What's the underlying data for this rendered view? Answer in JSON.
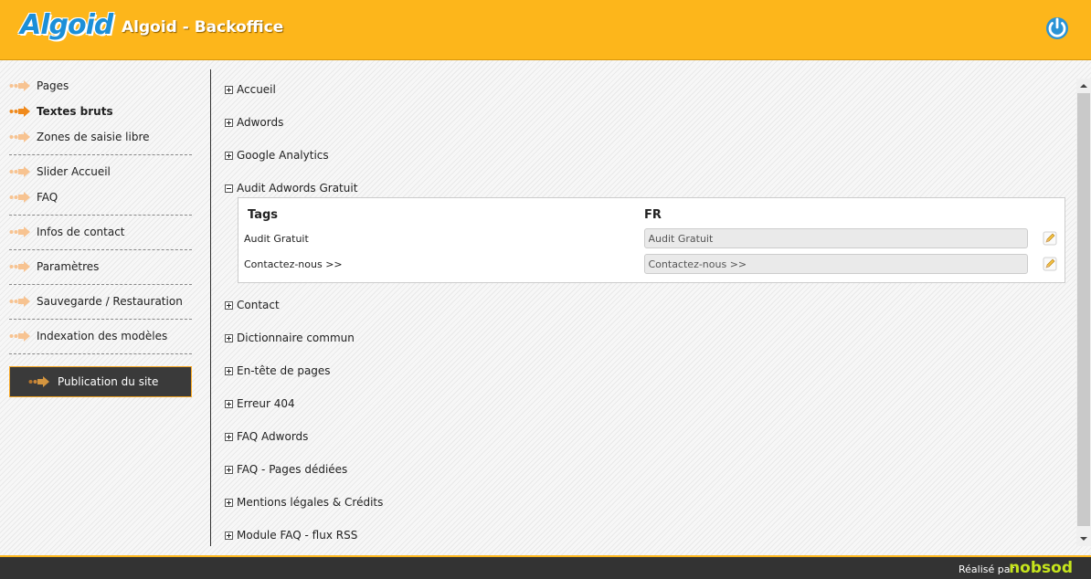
{
  "header": {
    "logo_text": "Algoid",
    "title": "Algoid - Backoffice",
    "power_icon": "power-icon",
    "color": "#fdb61b"
  },
  "sidebar": {
    "groups": [
      [
        {
          "label": "Pages",
          "active": false
        },
        {
          "label": "Textes bruts",
          "active": true
        },
        {
          "label": "Zones de saisie libre",
          "active": false
        }
      ],
      [
        {
          "label": "Slider Accueil",
          "active": false
        },
        {
          "label": "FAQ",
          "active": false
        }
      ],
      [
        {
          "label": "Infos de contact",
          "active": false
        }
      ],
      [
        {
          "label": "Paramètres",
          "active": false
        }
      ],
      [
        {
          "label": "Sauvegarde / Restauration",
          "active": false
        }
      ],
      [
        {
          "label": "Indexation des modèles",
          "active": false
        }
      ]
    ],
    "publish_label": "Publication du site"
  },
  "content": {
    "sections_before": [
      "Accueil",
      "Adwords",
      "Google Analytics"
    ],
    "expanded": {
      "title": "Audit Adwords Gratuit",
      "col_tags": "Tags",
      "col_lang": "FR",
      "rows": [
        {
          "tag": "Audit Gratuit",
          "value": "Audit Gratuit"
        },
        {
          "tag": "Contactez-nous >>",
          "value": "Contactez-nous >>"
        }
      ]
    },
    "sections_after": [
      "Contact",
      "Dictionnaire commun",
      "En-tête de pages",
      "Erreur 404",
      "FAQ Adwords",
      "FAQ - Pages dédiées",
      "Mentions légales & Crédits",
      "Module FAQ - flux RSS"
    ]
  },
  "footer": {
    "credit": "Réalisé par",
    "brand": "nobsod"
  }
}
